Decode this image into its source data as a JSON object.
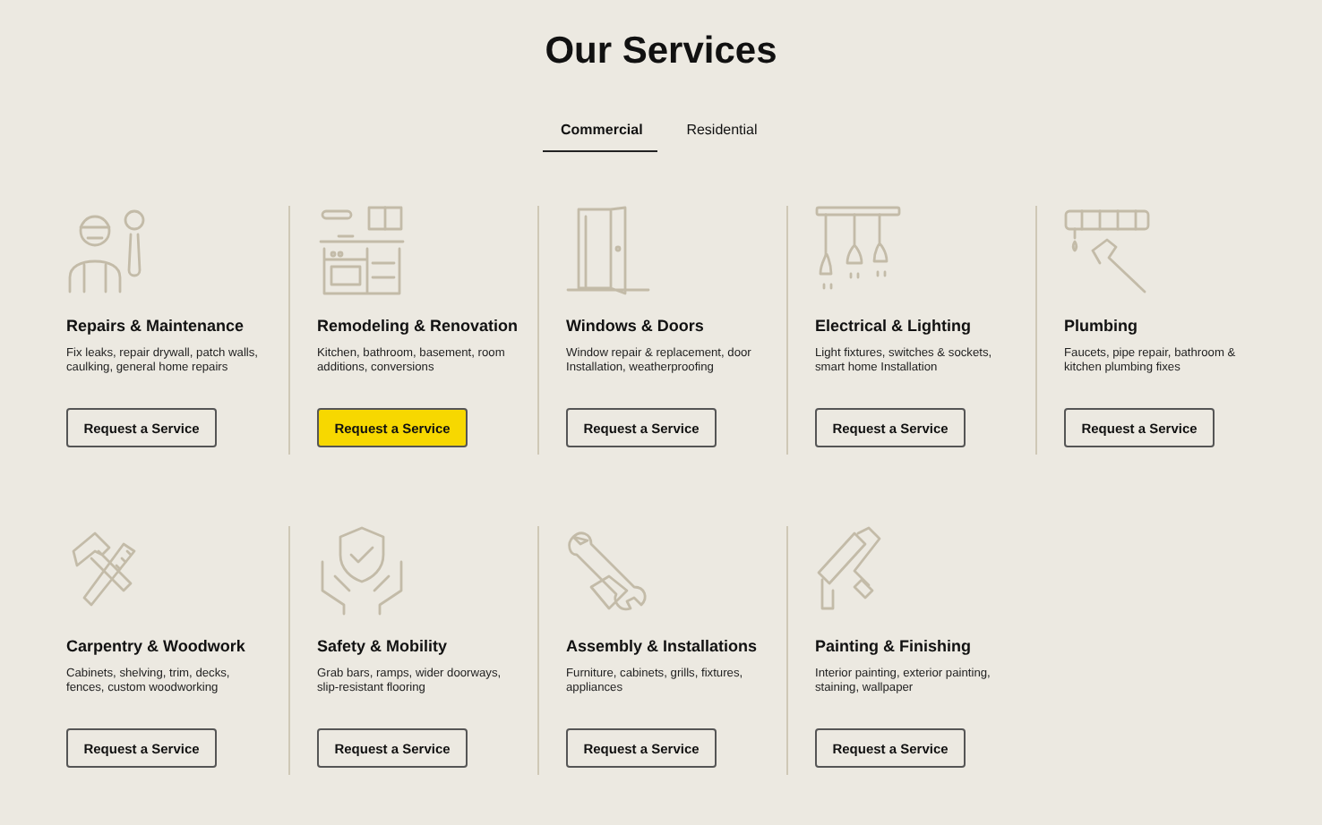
{
  "title": "Our Services",
  "tabs": [
    {
      "label": "Commercial",
      "selected": true
    },
    {
      "label": "Residential",
      "selected": false
    }
  ],
  "services": [
    {
      "title": "Repairs & Maintenance",
      "description": "Fix leaks, repair drywall, patch walls, caulking, general home repairs",
      "button": "Request a Service",
      "highlighted": false
    },
    {
      "title": "Remodeling & Renovation",
      "description": "Kitchen, bathroom, basement, room additions, conversions",
      "button": "Request a Service",
      "highlighted": true
    },
    {
      "title": "Windows & Doors",
      "description": "Window repair & replacement, door Installation, weatherproofing",
      "button": "Request a Service",
      "highlighted": false
    },
    {
      "title": "Electrical & Lighting",
      "description": "Light fixtures, switches & sockets, smart home Installation",
      "button": "Request a Service",
      "highlighted": false
    },
    {
      "title": "Plumbing",
      "description": "Faucets, pipe repair, bathroom & kitchen plumbing fixes",
      "button": "Request a Service",
      "highlighted": false
    },
    {
      "title": "Carpentry & Woodwork",
      "description": "Cabinets, shelving, trim, decks, fences, custom woodworking",
      "button": "Request a Service",
      "highlighted": false
    },
    {
      "title": "Safety & Mobility",
      "description": "Grab bars, ramps, wider doorways, slip-resistant flooring",
      "button": "Request a Service",
      "highlighted": false
    },
    {
      "title": "Assembly & Installations",
      "description": "Furniture, cabinets, grills, fixtures, appliances",
      "button": "Request a Service",
      "highlighted": false
    },
    {
      "title": "Painting & Finishing",
      "description": "Interior painting, exterior painting, staining, wallpaper",
      "button": "Request a Service",
      "highlighted": false
    }
  ]
}
